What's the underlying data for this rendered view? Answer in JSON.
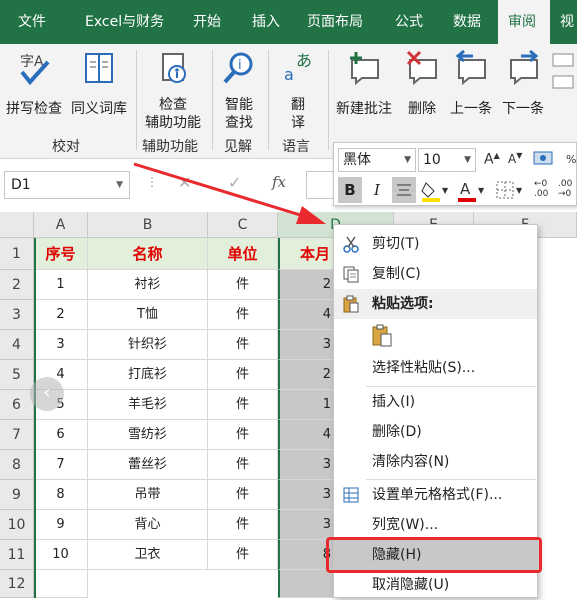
{
  "tabs": [
    "文件",
    "Excel与财务",
    "开始",
    "插入",
    "页面布局",
    "公式",
    "数据",
    "审阅",
    "视"
  ],
  "ribbon": {
    "spell": "拼写检查",
    "thesaurus": "同义词库",
    "group_proofing": "校对",
    "check_access_1": "检查",
    "check_access_2": "辅助功能",
    "group_access": "辅助功能",
    "smart_1": "智能",
    "smart_2": "查找",
    "group_insights": "见解",
    "translate_1": "翻",
    "translate_2": "译",
    "group_language": "语言",
    "new_comment": "新建批注",
    "delete": "删除",
    "prev": "上一条",
    "next": "下一条",
    "group_comments": "批注"
  },
  "namebox": "D1",
  "fx": "fx",
  "mini_toolbar": {
    "font": "黑体",
    "size": "10"
  },
  "columns": [
    "A",
    "B",
    "C",
    "D",
    "E",
    "F"
  ],
  "rows": [
    "1",
    "2",
    "3",
    "4",
    "5",
    "6",
    "7",
    "8",
    "9",
    "10",
    "11",
    "12"
  ],
  "header": {
    "a": "序号",
    "b": "名称",
    "c": "单位",
    "d": "本月"
  },
  "data": [
    {
      "a": "1",
      "b": "衬衫",
      "c": "件",
      "d": "2"
    },
    {
      "a": "2",
      "b": "T恤",
      "c": "件",
      "d": "4"
    },
    {
      "a": "3",
      "b": "针织衫",
      "c": "件",
      "d": "3"
    },
    {
      "a": "4",
      "b": "打底衫",
      "c": "件",
      "d": "2"
    },
    {
      "a": "5",
      "b": "羊毛衫",
      "c": "件",
      "d": "1"
    },
    {
      "a": "6",
      "b": "雪纺衫",
      "c": "件",
      "d": "4"
    },
    {
      "a": "7",
      "b": "蕾丝衫",
      "c": "件",
      "d": "3"
    },
    {
      "a": "8",
      "b": "吊带",
      "c": "件",
      "d": "3"
    },
    {
      "a": "9",
      "b": "背心",
      "c": "件",
      "d": "3"
    },
    {
      "a": "10",
      "b": "卫衣",
      "c": "件",
      "d": "8"
    }
  ],
  "menu": {
    "cut": "剪切(T)",
    "copy": "复制(C)",
    "paste_options": "粘贴选项:",
    "paste_special": "选择性粘贴(S)...",
    "insert": "插入(I)",
    "delete": "删除(D)",
    "clear": "清除内容(N)",
    "format": "设置单元格格式(F)...",
    "width": "列宽(W)...",
    "hide": "隐藏(H)",
    "unhide": "取消隐藏(U)"
  },
  "colors": {
    "excel_green": "#217346",
    "red": "#e8292d",
    "header_fill": "#e2efda"
  }
}
